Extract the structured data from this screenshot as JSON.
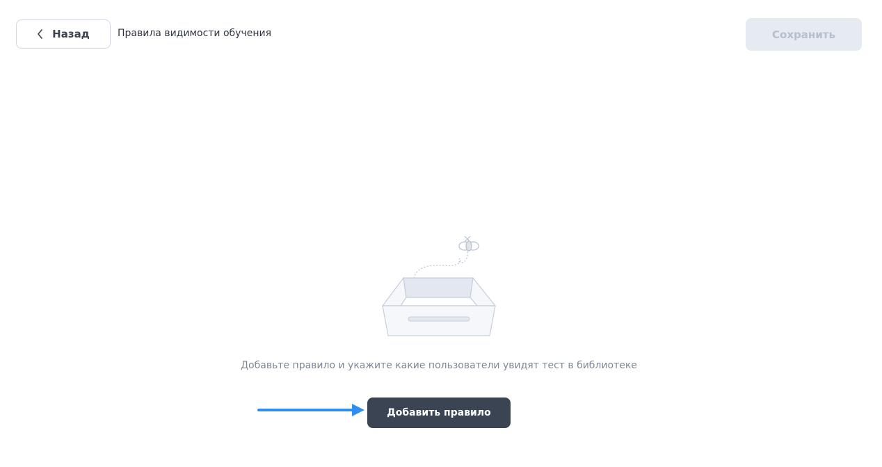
{
  "header": {
    "back_label": "Назад",
    "title": "Правила видимости обучения",
    "save_label": "Сохранить"
  },
  "empty_state": {
    "message": "Добавьте правило и укажите какие пользователи увидят тест в библиотеке",
    "add_rule_label": "Добавить правило"
  },
  "colors": {
    "primary_button": "#3b4452",
    "disabled_button": "#e6eaf1",
    "annotation_arrow": "#2f8ff0"
  }
}
